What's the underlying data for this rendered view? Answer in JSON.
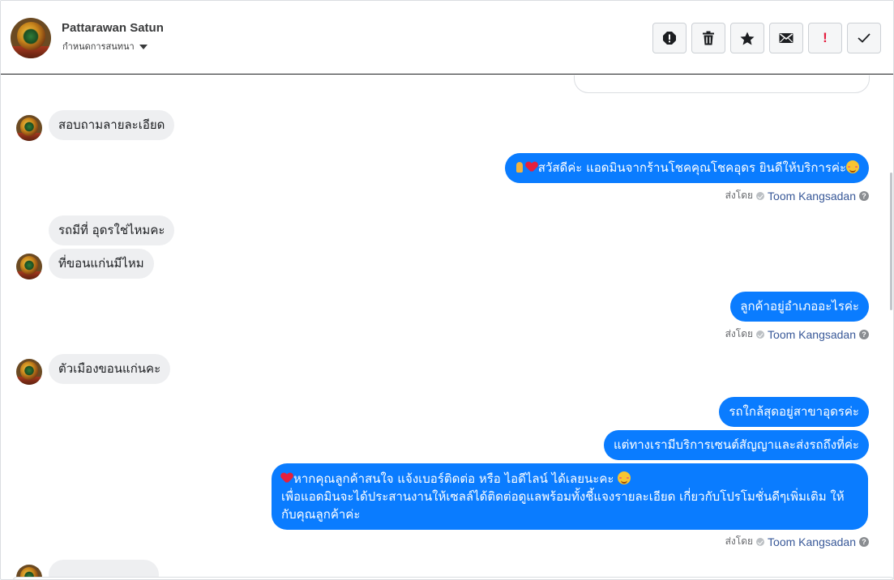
{
  "header": {
    "contact_name": "Pattarawan Satun",
    "label_text": "กำหนดการสนทนา",
    "avatar_icon": "profile-photo"
  },
  "toolbar": {
    "buttons": [
      {
        "name": "report-icon",
        "icon": "exclamation-circle"
      },
      {
        "name": "trash-icon",
        "icon": "trash"
      },
      {
        "name": "star-icon",
        "icon": "star"
      },
      {
        "name": "mail-icon",
        "icon": "envelope"
      },
      {
        "name": "important-icon",
        "icon": "exclamation",
        "glyph": "!"
      },
      {
        "name": "check-icon",
        "icon": "checkmark"
      }
    ]
  },
  "colors": {
    "outgoing_bubble": "#0a7cff",
    "incoming_bubble": "#eeeff1",
    "agent_link": "#385898"
  },
  "messages": [
    {
      "dir": "in",
      "text": "สอบถามลายละเอียด"
    },
    {
      "dir": "out",
      "text": "สวัสดีค่ะ แอดมินจากร้านโชคคุณโชคอุดร ยินดีให้บริการค่ะ",
      "prefix_emoji": [
        "pray",
        "heart"
      ],
      "suffix_emoji": "smile"
    },
    {
      "dir": "in",
      "text": "รถมีที่ อุดรใช่ไหมคะ"
    },
    {
      "dir": "in",
      "text": "ที่ขอนแก่นมีไหม"
    },
    {
      "dir": "out",
      "text": "ลูกค้าอยู่อำเภออะไรค่ะ"
    },
    {
      "dir": "in",
      "text": "ตัวเมืองขอนแก่นคะ"
    },
    {
      "dir": "out",
      "text": "รถใกล้สุดอยู่สาขาอุดรค่ะ"
    },
    {
      "dir": "out",
      "text": "แต่ทางเรามีบริการเซนต์สัญญาและส่งรถถึงที่ค่ะ"
    },
    {
      "dir": "out",
      "line1": "หากคุณลูกค้าสนใจ แจ้งเบอร์ติดต่อ หรือ ไอดีไลน์ ได้เลยนะคะ",
      "line2": "เพื่อแอดมินจะได้ประสานงานให้เซลล์ได้ติดต่อดูแลพร้อมทั้งชี้แจงรายละเอียด เกี่ยวกับโปรโมชั่นดีๆเพิ่มเติม ให้",
      "line3": "กับคุณลูกค้าค่ะ"
    }
  ],
  "sent_by": {
    "prefix": "ส่งโดย",
    "agent": "Toom Kangsadan",
    "help": "?"
  }
}
